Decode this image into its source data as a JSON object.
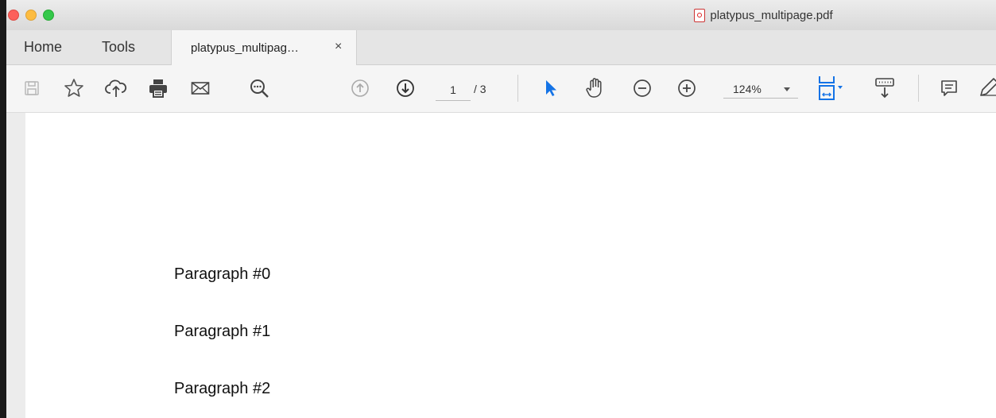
{
  "window": {
    "title": "platypus_multipage.pdf"
  },
  "nav": {
    "home": "Home",
    "tools": "Tools",
    "doc_tab": {
      "label": "platypus_multipag…",
      "close": "×"
    }
  },
  "toolbar": {
    "current_page": "1",
    "page_total": "/ 3",
    "zoom": "124%",
    "icons": [
      "save-icon",
      "bookmark-star-icon",
      "cloud-upload-icon",
      "print-icon",
      "email-icon",
      "search-icon",
      "page-up-icon",
      "page-down-icon",
      "select-arrow-icon",
      "hand-icon",
      "zoom-out-icon",
      "zoom-in-icon",
      "fit-page-icon",
      "keyboard-read-icon",
      "comment-icon",
      "edit-pen-icon"
    ],
    "accent": "#1473e6"
  },
  "document": {
    "paragraphs": [
      "Paragraph #0",
      "Paragraph #1",
      "Paragraph #2"
    ]
  }
}
